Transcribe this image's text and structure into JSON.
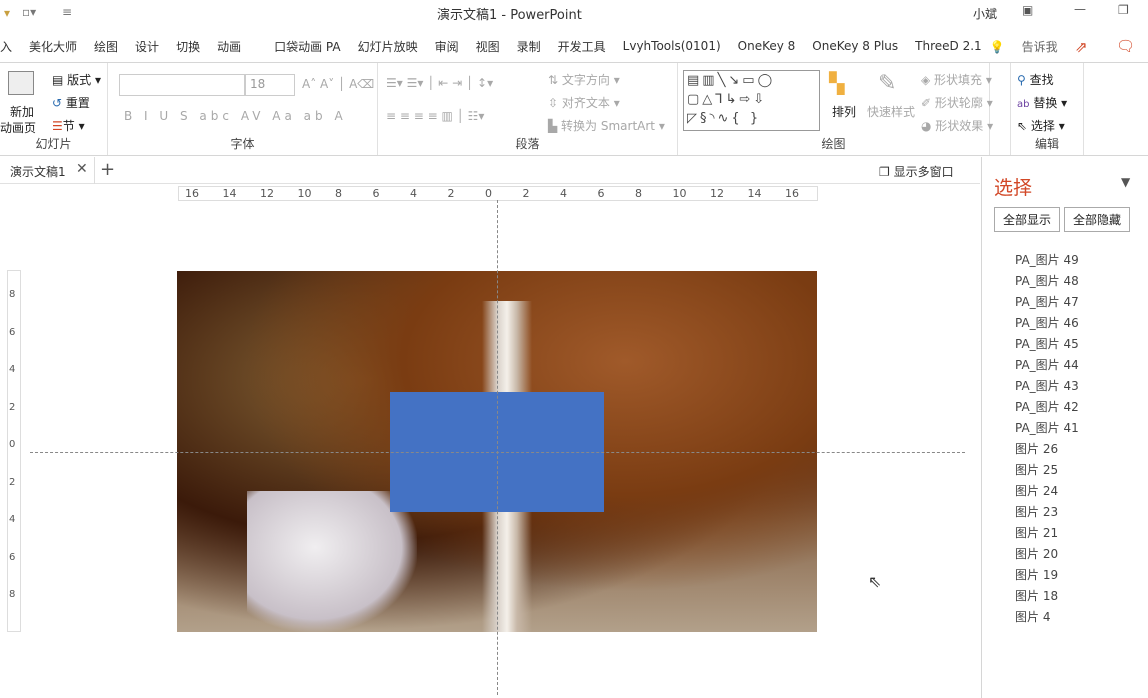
{
  "titlebar": {
    "title": "演示文稿1  -  PowerPoint",
    "user": "小斌"
  },
  "tabs": [
    "入",
    "美化大师",
    "绘图",
    "设计",
    "切换",
    "动画",
    "口袋动画 PA",
    "幻灯片放映",
    "审阅",
    "视图",
    "录制",
    "开发工具",
    "LvyhTools(0101)",
    "OneKey 8",
    "OneKey 8 Plus",
    "ThreeD 2.1"
  ],
  "tell_me": "告诉我",
  "ribbon": {
    "slides": {
      "label": "幻灯片",
      "new_slide": "新加",
      "new_slide2": "动画页",
      "layout": "版式",
      "reset": "重置",
      "section": "节"
    },
    "font": {
      "label": "字体",
      "size": "18"
    },
    "paragraph": {
      "label": "段落",
      "text_direction": "文字方向",
      "align_text": "对齐文本",
      "smartart": "转换为 SmartArt"
    },
    "drawing": {
      "label": "绘图",
      "arrange": "排列",
      "quick_styles": "快速样式",
      "fill": "形状填充",
      "outline": "形状轮廓",
      "effects": "形状效果"
    },
    "editing": {
      "label": "编辑",
      "find": "查找",
      "replace": "替换",
      "select": "选择"
    }
  },
  "doc": {
    "tab": "演示文稿1",
    "multi_window": "显示多窗口"
  },
  "ruler": [
    "16",
    "14",
    "12",
    "10",
    "8",
    "6",
    "4",
    "2",
    "0",
    "2",
    "4",
    "6",
    "8",
    "10",
    "12",
    "14",
    "16"
  ],
  "vruler": [
    "8",
    "6",
    "4",
    "2",
    "0",
    "2",
    "4",
    "6",
    "8"
  ],
  "pane": {
    "title": "选择",
    "show_all": "全部显示",
    "hide_all": "全部隐藏",
    "items": [
      "PA_图片 49",
      "PA_图片 48",
      "PA_图片 47",
      "PA_图片 46",
      "PA_图片 45",
      "PA_图片 44",
      "PA_图片 43",
      "PA_图片 42",
      "PA_图片 41",
      "图片 26",
      "图片 25",
      "图片 24",
      "图片 23",
      "图片 21",
      "图片 20",
      "图片 19",
      "图片 18",
      "图片 4"
    ]
  },
  "colors": {
    "accent": "#d24726",
    "shape": "#4472c4"
  }
}
